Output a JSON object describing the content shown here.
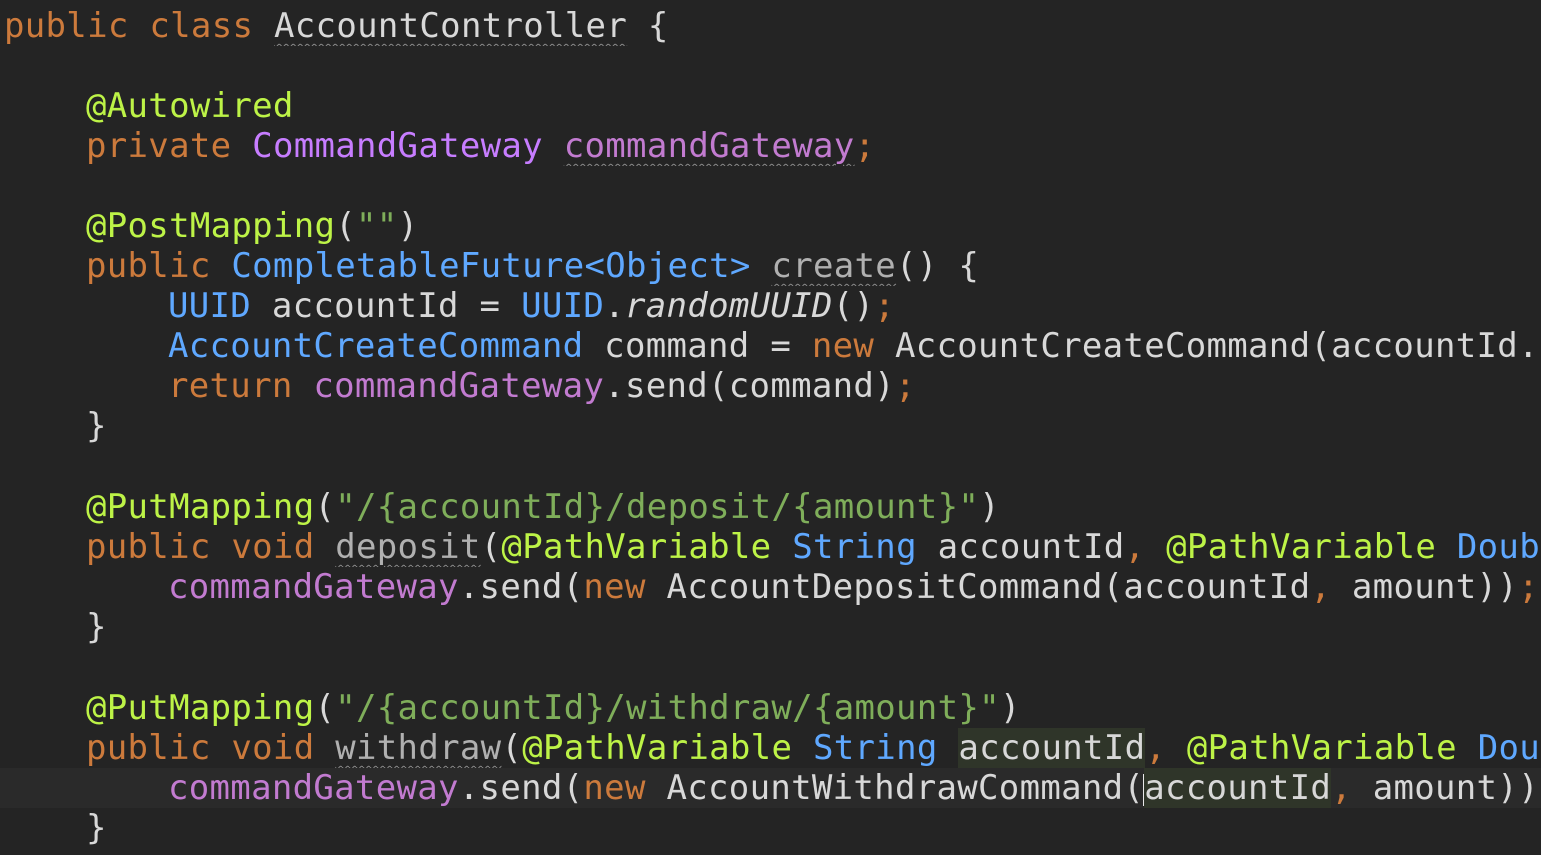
{
  "lines": {
    "l1": {
      "kw": "public class ",
      "cls": "AccountController",
      "end": " {"
    },
    "l3": {
      "ann": "@Autowired"
    },
    "l4": {
      "kw": "private ",
      "type": "CommandGateway",
      "sp": " ",
      "field": "commandGateway",
      "semi": ";"
    },
    "l6": {
      "ann": "@PostMapping",
      "p1": "(",
      "str": "\"\"",
      "p2": ")"
    },
    "l7": {
      "kw": "public ",
      "type": "CompletableFuture<Object>",
      "sp": " ",
      "name": "create",
      "end": "() {"
    },
    "l8": {
      "type1": "UUID",
      "mid": " accountId = ",
      "type2": "UUID",
      "dot": ".",
      "call": "randomUUID",
      "paren": "()",
      "semi": ";"
    },
    "l9": {
      "type": "AccountCreateCommand",
      "mid": " command = ",
      "kw": "new",
      "rest": " AccountCreateCommand(accountId.t"
    },
    "l10": {
      "kw": "return ",
      "field": "commandGateway",
      "rest": ".send(command)",
      "semi": ";"
    },
    "l11": {
      "brace": "}"
    },
    "l13": {
      "ann": "@PutMapping",
      "p1": "(",
      "str": "\"/{accountId}/deposit/{amount}\"",
      "p2": ")"
    },
    "l14": {
      "kw": "public void ",
      "name": "deposit",
      "p": "(",
      "ann1": "@PathVariable",
      "sp1": " ",
      "type": "String",
      "arg": " accountId",
      "comma": ", ",
      "ann2": "@PathVariable",
      "sp2": " ",
      "type2": "Doub"
    },
    "l15": {
      "field": "commandGateway",
      "send": ".send(",
      "kw": "new",
      "rest1": " AccountDepositCommand(accountId",
      "comma": ",",
      "rest2": " amount))",
      "semi": ";"
    },
    "l16": {
      "brace": "}"
    },
    "l18": {
      "ann": "@PutMapping",
      "p1": "(",
      "str": "\"/{accountId}/withdraw/{amount}\"",
      "p2": ")"
    },
    "l19": {
      "kw": "public void ",
      "name": "withdraw",
      "p": "(",
      "ann1": "@PathVariable",
      "sp1": " ",
      "type": "String",
      "sp3": " ",
      "arg": "accountId",
      "comma": ", ",
      "ann2": "@PathVariable",
      "sp2": " ",
      "type2": "Dou"
    },
    "l20": {
      "field": "commandGateway",
      "send": ".send(",
      "kw": "new",
      "rest1": " AccountWithdrawCommand(",
      "arg": "accountId",
      "comma": ",",
      "rest2": " amount))"
    },
    "l21": {
      "brace": "}"
    }
  }
}
